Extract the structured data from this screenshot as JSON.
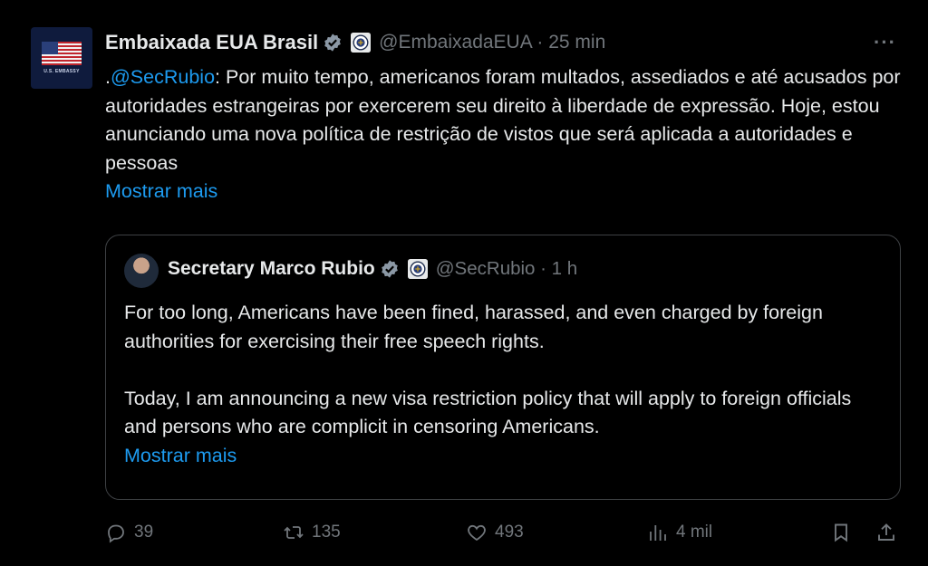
{
  "tweet": {
    "author_name": "Embaixada EUA Brasil",
    "handle_time": "@EmbaixadaEUA · 25 min",
    "avatar_text": "U.S. EMBASSY",
    "more_icon": "more-horizontal-icon",
    "body_prefix": ".",
    "body_mention": "@SecRubio",
    "body_text": ": Por muito tempo, americanos foram multados, assediados e até acusados por autoridades estrangeiras por exercerem seu direito à liberdade de expressão. Hoje, estou anunciando uma nova política de restrição de vistos que será aplicada a autoridades e pessoas",
    "show_more": "Mostrar mais"
  },
  "quote": {
    "author_name": "Secretary Marco Rubio",
    "handle_time": "@SecRubio · 1 h",
    "paragraph1": "For too long, Americans have been fined, harassed, and even charged by foreign authorities for exercising their free speech rights.",
    "paragraph2": "Today, I am announcing a new visa restriction policy that will apply to foreign officials and persons who are complicit in censoring Americans.",
    "show_more": "Mostrar mais"
  },
  "actions": {
    "replies": "39",
    "reposts": "135",
    "likes": "493",
    "views": "4 mil"
  },
  "colors": {
    "background": "#000000",
    "text": "#e7e9ea",
    "muted": "#71767b",
    "link": "#1d9bf0",
    "verified_badge": "#8b98a5"
  }
}
